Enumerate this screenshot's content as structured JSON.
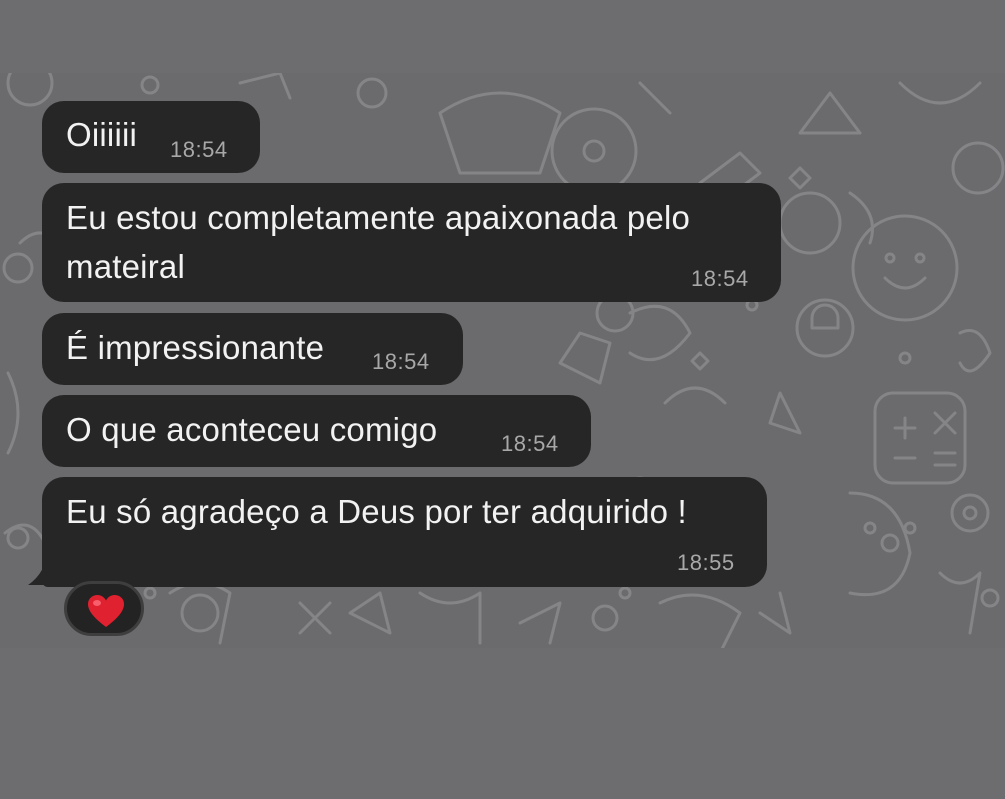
{
  "colors": {
    "page_background": "#6d6d70",
    "chat_background": "#6b6b6e",
    "bubble": "#262626",
    "bubble_text": "#f2f2f2",
    "timestamp": "#a8a8a8",
    "reaction_heart": "#e0212f"
  },
  "messages": [
    {
      "text": "Oiiiiii",
      "time": "18:54"
    },
    {
      "lines": [
        "Eu estou completamente apaixonada pelo",
        "mateiral"
      ],
      "time": "18:54"
    },
    {
      "text": "É impressionante",
      "time": "18:54"
    },
    {
      "text": "O que aconteceu comigo",
      "time": "18:54"
    },
    {
      "text": "Eu só agradeço a Deus por ter adquirido !",
      "time": "18:55"
    }
  ],
  "reaction": {
    "emoji_icon": "red-heart-icon"
  },
  "background_icon": "chat-doodle-pattern"
}
